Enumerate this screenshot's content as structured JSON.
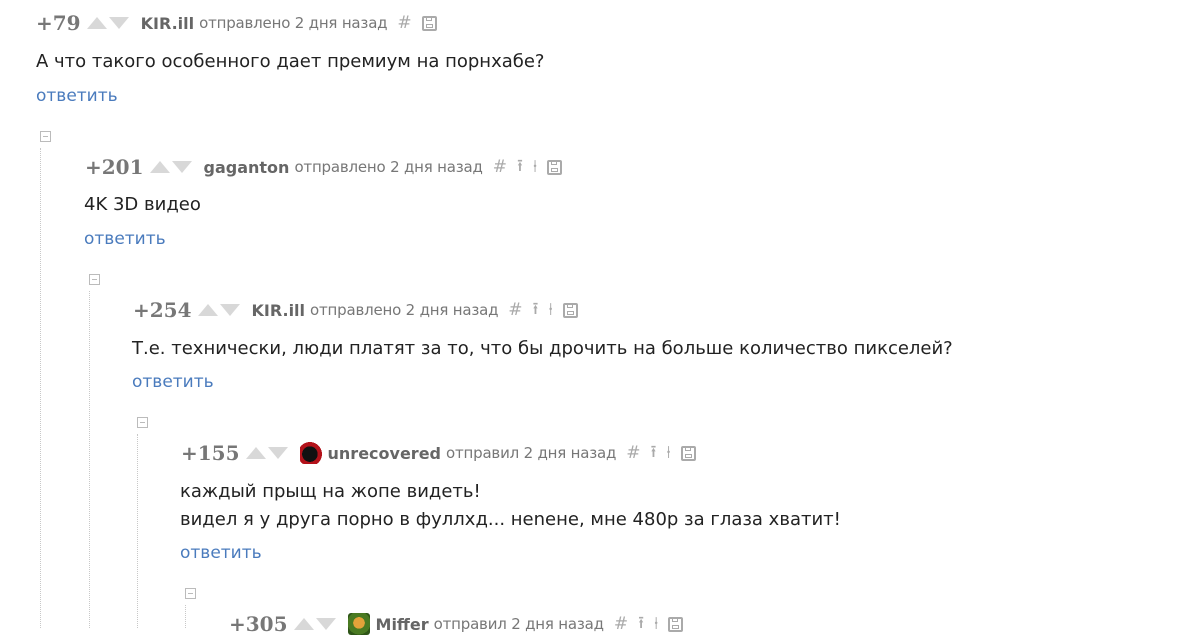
{
  "comments": [
    {
      "rating": "+79",
      "author": "KIR.ill",
      "sent": "отправлено 2 дня назад",
      "text": [
        "А что такого особенного дает премиум на порнхабе?"
      ],
      "reply": "ответить"
    },
    {
      "rating": "+201",
      "author": "gaganton",
      "sent": "отправлено 2 дня назад",
      "text": [
        "4K 3D видео"
      ],
      "reply": "ответить"
    },
    {
      "rating": "+254",
      "author": "KIR.ill",
      "sent": "отправлено 2 дня назад",
      "text": [
        "Т.е. технически, люди платят за то, что бы дрочить на больше количество пикселей?"
      ],
      "reply": "ответить"
    },
    {
      "rating": "+155",
      "author": "unrecovered",
      "sent": "отправил 2 дня назад",
      "text": [
        "каждый прыщ на жопе видеть!",
        "видел я у друга порно в фуллхд... нenене, мне 480р за глаза хватит!"
      ],
      "reply": "ответить"
    },
    {
      "rating": "+305",
      "author": "Miffer",
      "sent": "отправил 2 дня назад",
      "text": [],
      "reply": ""
    }
  ],
  "icons": {
    "hash": "#",
    "parent": "⭱",
    "thread": "⍿"
  }
}
